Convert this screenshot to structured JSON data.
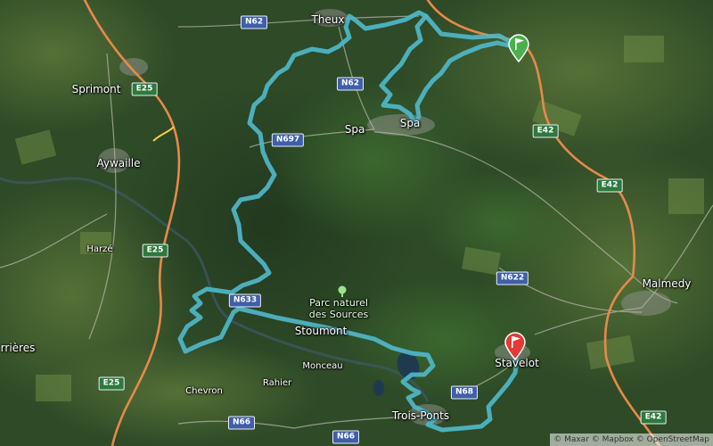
{
  "map": {
    "places": [
      {
        "name": "Theux",
        "key": "theux"
      },
      {
        "name": "Sprimont",
        "key": "sprimont"
      },
      {
        "name": "Aywaille",
        "key": "aywaille"
      },
      {
        "name": "Spa",
        "key": "spa-west"
      },
      {
        "name": "Spa",
        "key": "spa"
      },
      {
        "name": "Harzé",
        "key": "harze"
      },
      {
        "name": "Stoumont",
        "key": "stoumont"
      },
      {
        "name": "Monceau",
        "key": "monceau"
      },
      {
        "name": "Rahier",
        "key": "rahier"
      },
      {
        "name": "Chevron",
        "key": "chevron"
      },
      {
        "name": "Trois-Ponts",
        "key": "trois-ponts"
      },
      {
        "name": "Stavelot",
        "key": "stavelot"
      },
      {
        "name": "Malmedy",
        "key": "malmedy"
      },
      {
        "name": "rrières",
        "key": "aywaille-rrieres"
      }
    ],
    "park_label": "Parc naturel des Sources",
    "road_shields": [
      {
        "label": "N62",
        "type": "n",
        "key": "n62-top"
      },
      {
        "label": "N62",
        "type": "n",
        "key": "n62-mid"
      },
      {
        "label": "E25",
        "type": "e",
        "key": "e25-top"
      },
      {
        "label": "E25",
        "type": "e",
        "key": "e25-mid"
      },
      {
        "label": "E25",
        "type": "e",
        "key": "e25-bottom"
      },
      {
        "label": "N697",
        "type": "n",
        "key": "n697"
      },
      {
        "label": "E42",
        "type": "e",
        "key": "e42-top"
      },
      {
        "label": "E42",
        "type": "e",
        "key": "e42-mid"
      },
      {
        "label": "E42",
        "type": "e",
        "key": "e42-bottom"
      },
      {
        "label": "N633",
        "type": "n",
        "key": "n633"
      },
      {
        "label": "N622",
        "type": "n",
        "key": "n622"
      },
      {
        "label": "N68",
        "type": "n",
        "key": "n68"
      },
      {
        "label": "N66",
        "type": "n",
        "key": "n66-left"
      },
      {
        "label": "N66",
        "type": "n",
        "key": "n66-right"
      }
    ],
    "markers": {
      "start": {
        "name": "start-flag",
        "color": "#4caf50"
      },
      "end": {
        "name": "finish-flag",
        "color": "#e53935"
      }
    },
    "route_color": "#4fb7c9",
    "motorway_color": "#e8894a",
    "attribution": "© Maxar © Mapbox © OpenStreetMap"
  }
}
